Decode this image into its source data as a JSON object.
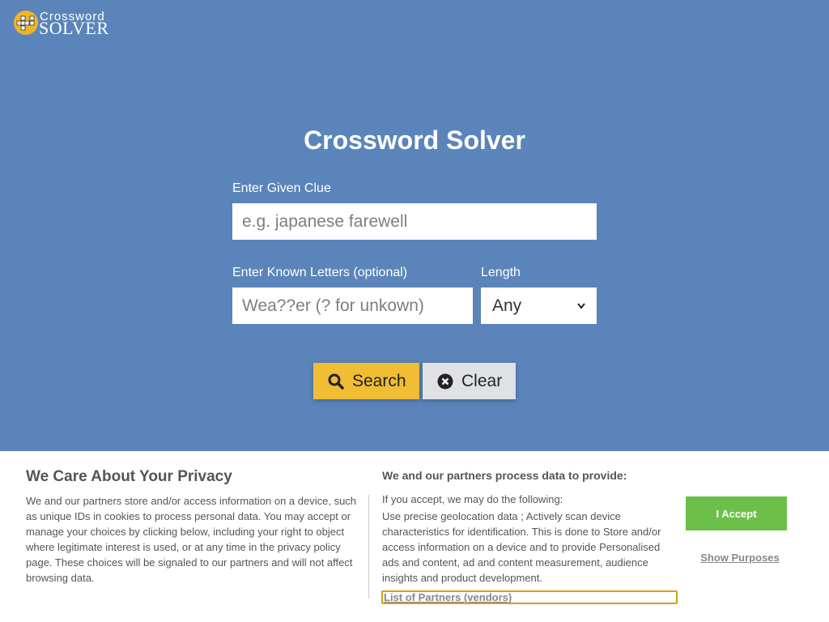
{
  "logo": {
    "line1": "Crossword",
    "line2": "SOLVER"
  },
  "hero": {
    "title": "Crossword Solver"
  },
  "form": {
    "clue_label": "Enter Given Clue",
    "clue_placeholder": "e.g. japanese farewell",
    "clue_value": "",
    "letters_label": "Enter Known Letters (optional)",
    "letters_placeholder": "Wea??er (? for unkown)",
    "letters_value": "",
    "length_label": "Length",
    "length_selected": "Any",
    "search_label": "Search",
    "clear_label": "Clear"
  },
  "privacy": {
    "title": "We Care About Your Privacy",
    "body": "We and our partners store and/or access information on a device, such as unique IDs in cookies to process personal data. You may accept or manage your choices by clicking below, including your right to object where legitimate interest is used, or at any time in the privacy policy page. These choices will be signaled to our partners and will not affect browsing data.",
    "heading": "We and our partners process data to provide:",
    "intro": "If you accept, we may do the following:",
    "purposes": "Use precise geolocation data ; Actively scan device characteristics for identification. This is done to Store and/or access information on a device and to provide Personalised ads and content, ad and content measurement, audience insights and product development.",
    "partners_link": "List of Partners (vendors)",
    "accept_label": "I Accept",
    "show_purposes_label": "Show Purposes"
  },
  "colors": {
    "hero_bg": "#5b85ba",
    "search_button": "#f0bd34",
    "clear_button": "#dfe1e5",
    "accept_button": "#6cc04a",
    "logo_accent": "#f0b429"
  },
  "icons": {
    "search": "search-icon",
    "clear": "close-circle-icon",
    "logo": "crossword-grid-icon",
    "select": "chevron-down-icon"
  }
}
